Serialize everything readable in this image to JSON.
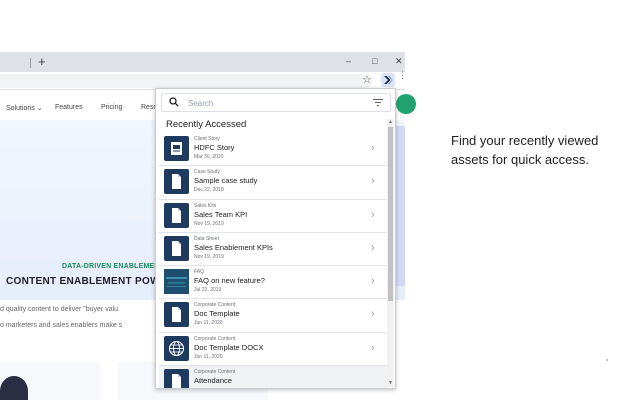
{
  "browser": {
    "new_tab": "+",
    "window_controls": [
      "–",
      "□",
      "✕"
    ],
    "star": "☆",
    "menu": "⋮"
  },
  "website": {
    "nav": [
      "Solutions",
      "Features",
      "Pricing",
      "Reso"
    ],
    "nav_chevron": "⌄",
    "tagline": "DATA-DRIVEN ENABLEMENT",
    "hero_title": "CONTENT ENABLEMENT POWERE",
    "hero_sub_1": "d quality content to deliver \"buyer valu",
    "hero_sub_2": "o marketers and sales enablers make s"
  },
  "popup": {
    "search_placeholder": "Search",
    "section_title": "Recently Accessed",
    "items": [
      {
        "category": "Client Story",
        "name": "HDFC Story",
        "date": "Mar 30, 2020",
        "icon": "presentation-icon"
      },
      {
        "category": "Case Study",
        "name": "Sample case study",
        "date": "Dec 22, 2018",
        "icon": "document-icon"
      },
      {
        "category": "Sales Kits",
        "name": "Sales Team KPI",
        "date": "Nov 19, 2019",
        "icon": "document-icon"
      },
      {
        "category": "Data Sheet",
        "name": "Sales Enablement KPIs",
        "date": "Nov 19, 2019",
        "icon": "document-icon"
      },
      {
        "category": "FAQ",
        "name": "FAQ on new feature?",
        "date": "Jul 23, 2019",
        "icon": "image-thumbnail"
      },
      {
        "category": "Corporate Content",
        "name": "Doc Template",
        "date": "Jun 11, 2020",
        "icon": "document-icon"
      },
      {
        "category": "Corporate Content",
        "name": "Doc Template DOCX",
        "date": "Jun 11, 2020",
        "icon": "globe-icon"
      },
      {
        "category": "Corporate Content",
        "name": "Attendance",
        "date": "",
        "icon": "document-icon"
      }
    ],
    "chevron": "›",
    "scroll_up": "▲",
    "scroll_down": "▼"
  },
  "caption": "Find your recently viewed assets for quick access.",
  "colors": {
    "thumbnail_bg": "#1e3a5f",
    "brand_green": "#1fa36f",
    "hero_bg": "#e6edfb"
  }
}
